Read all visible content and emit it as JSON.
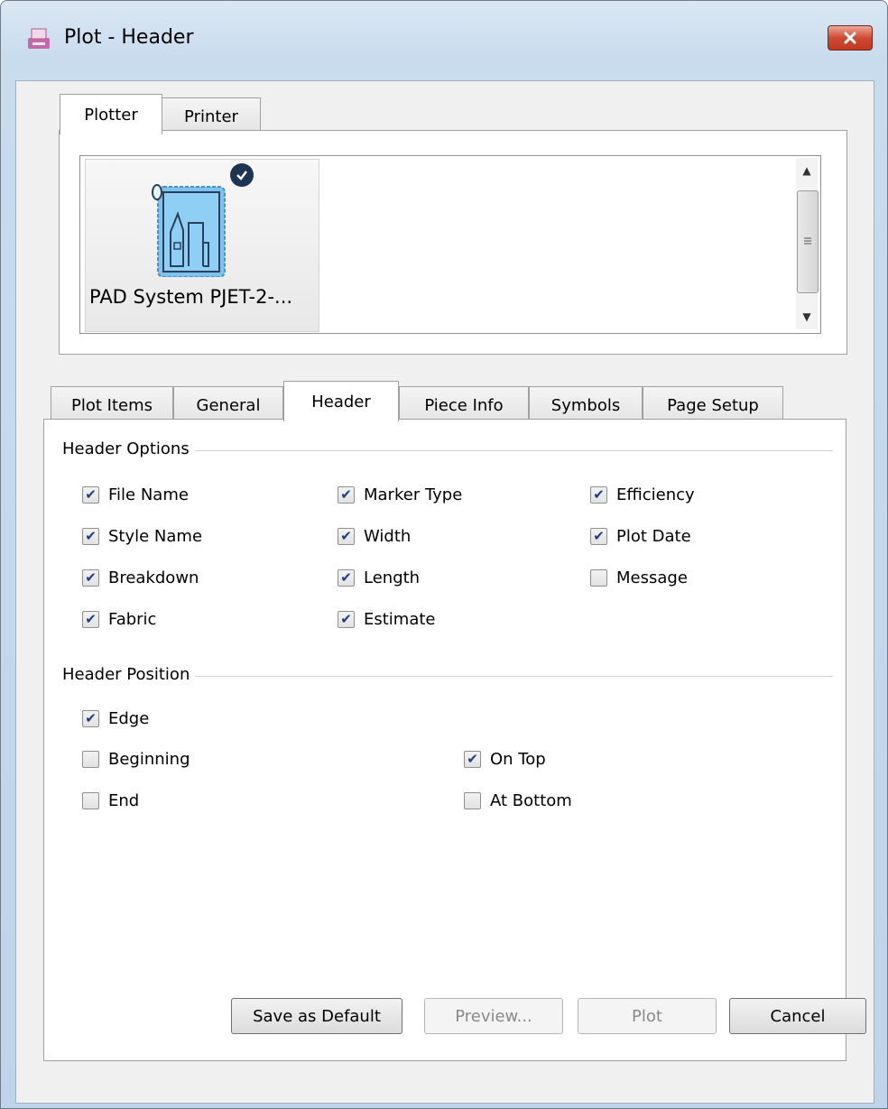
{
  "window": {
    "title": "Plot - Header"
  },
  "top_tabs": [
    {
      "label": "Plotter",
      "active": true
    },
    {
      "label": "Printer",
      "active": false
    }
  ],
  "device": {
    "label": "PAD System PJET-2-...",
    "selected": true
  },
  "main_tabs": [
    {
      "label": "Plot Items",
      "active": false
    },
    {
      "label": "General",
      "active": false
    },
    {
      "label": "Header",
      "active": true
    },
    {
      "label": "Piece Info",
      "active": false
    },
    {
      "label": "Symbols",
      "active": false
    },
    {
      "label": "Page Setup",
      "active": false
    }
  ],
  "header_options": {
    "title": "Header Options",
    "items": [
      {
        "label": "File Name",
        "checked": true
      },
      {
        "label": "Marker Type",
        "checked": true
      },
      {
        "label": "Efficiency",
        "checked": true
      },
      {
        "label": "Style Name",
        "checked": true
      },
      {
        "label": "Width",
        "checked": true
      },
      {
        "label": "Plot Date",
        "checked": true
      },
      {
        "label": "Breakdown",
        "checked": true
      },
      {
        "label": "Length",
        "checked": true
      },
      {
        "label": "Message",
        "checked": false
      },
      {
        "label": "Fabric",
        "checked": true
      },
      {
        "label": "Estimate",
        "checked": true
      }
    ]
  },
  "header_position": {
    "title": "Header Position",
    "items": [
      {
        "label": "Edge",
        "checked": true
      },
      {
        "label": "Beginning",
        "checked": false
      },
      {
        "label": "On Top",
        "checked": true
      },
      {
        "label": "End",
        "checked": false
      },
      {
        "label": "At Bottom",
        "checked": false
      }
    ]
  },
  "buttons": {
    "save_default": "Save as Default",
    "preview": "Preview...",
    "plot": "Plot",
    "cancel": "Cancel"
  },
  "colors": {
    "accent": "#1d3553",
    "check": "#1e3c8a",
    "close": "#c0391f"
  }
}
